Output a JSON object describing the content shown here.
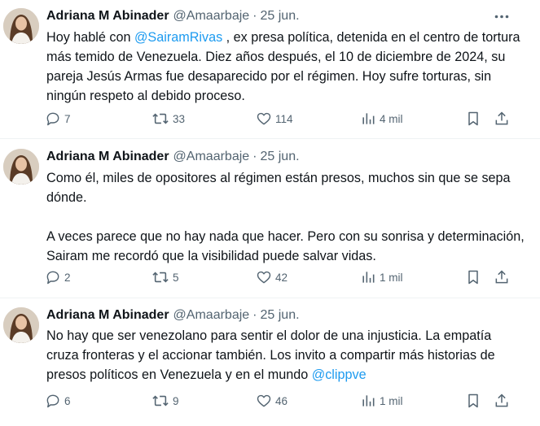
{
  "tweets": [
    {
      "author": "Adriana M Abinader",
      "handle": "@Amaarbaje",
      "separator": "·",
      "date": "25 jun.",
      "text_before_mention": "Hoy hablé con ",
      "mention": "@SairamRivas",
      "text_after_mention": " , ex presa política, detenida en el centro de tortura más temido de Venezuela. Diez años después, el 10 de diciembre de 2024, su pareja Jesús Armas fue desaparecido por el régimen. Hoy sufre torturas, sin ningún respeto al debido proceso.",
      "replies": "7",
      "reposts": "33",
      "likes": "114",
      "views": "4 mil"
    },
    {
      "author": "Adriana M Abinader",
      "handle": "@Amaarbaje",
      "separator": "·",
      "date": "25 jun.",
      "text": "Como él, miles de opositores al régimen están presos, muchos sin que se sepa dónde.\n\nA veces parece que no hay nada que hacer. Pero con su sonrisa y determinación, Sairam me recordó que la visibilidad puede salvar vidas.",
      "replies": "2",
      "reposts": "5",
      "likes": "42",
      "views": "1 mil"
    },
    {
      "author": "Adriana M Abinader",
      "handle": "@Amaarbaje",
      "separator": "·",
      "date": "25 jun.",
      "text_before_mention": "No hay que ser venezolano para sentir el dolor de una injusticia. La empatía cruza fronteras y el accionar también. Los invito a compartir más historias de presos políticos en Venezuela y en el mundo ",
      "mention": "@clippve",
      "text_after_mention": "",
      "replies": "6",
      "reposts": "9",
      "likes": "46",
      "views": "1 mil"
    }
  ],
  "icons": {
    "more": "more-dots-icon",
    "reply": "reply-bubble-icon",
    "repost": "repost-arrows-icon",
    "like": "heart-icon",
    "views": "views-bar-chart-icon",
    "bookmark": "bookmark-icon",
    "share": "share-upload-icon"
  },
  "colors": {
    "text": "#0f1419",
    "muted": "#536471",
    "link": "#1d9bf0",
    "divider": "#eff3f4"
  }
}
